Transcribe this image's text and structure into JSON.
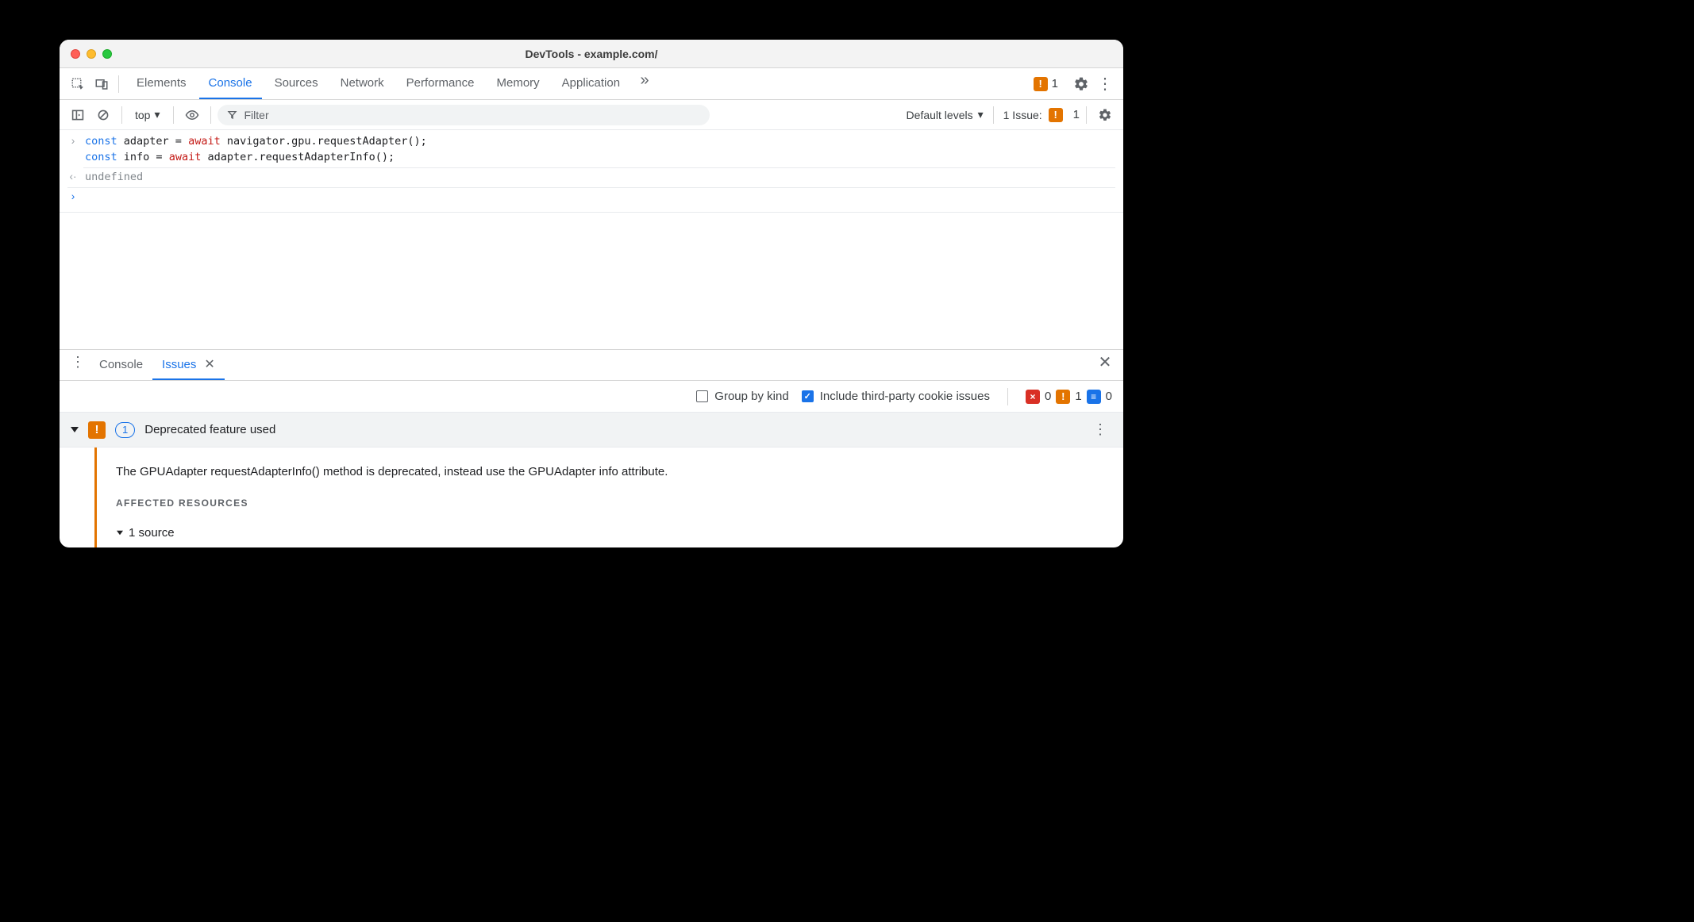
{
  "window": {
    "title": "DevTools - example.com/"
  },
  "topbar": {
    "tabs": [
      "Elements",
      "Console",
      "Sources",
      "Network",
      "Performance",
      "Memory",
      "Application"
    ],
    "active_tab_index": 1,
    "warn_count": "1"
  },
  "console_toolbar": {
    "context": "top",
    "filter_placeholder": "Filter",
    "levels_label": "Default levels",
    "issues_label": "1 Issue:",
    "issues_count": "1"
  },
  "console_lines": {
    "input1_pre": "const",
    "input1_var": " adapter ",
    "input1_eq": "= ",
    "input1_await": "await",
    "input1_rest": " navigator.gpu.requestAdapter();",
    "input2_pre": "const",
    "input2_var": " info ",
    "input2_eq": "= ",
    "input2_await": "await",
    "input2_rest": " adapter.requestAdapterInfo();",
    "result": "undefined"
  },
  "drawer": {
    "tabs": [
      "Console",
      "Issues"
    ],
    "active_tab_index": 1
  },
  "issues_opts": {
    "group_label": "Group by kind",
    "group_checked": false,
    "third_party_label": "Include third-party cookie issues",
    "third_party_checked": true,
    "err_count": "0",
    "warn_count": "1",
    "info_count": "0"
  },
  "issue": {
    "badge_count": "1",
    "title": "Deprecated feature used",
    "message": "The GPUAdapter requestAdapterInfo() method is deprecated, instead use the GPUAdapter info attribute.",
    "affected_label": "AFFECTED RESOURCES",
    "source_text": "1 source"
  }
}
